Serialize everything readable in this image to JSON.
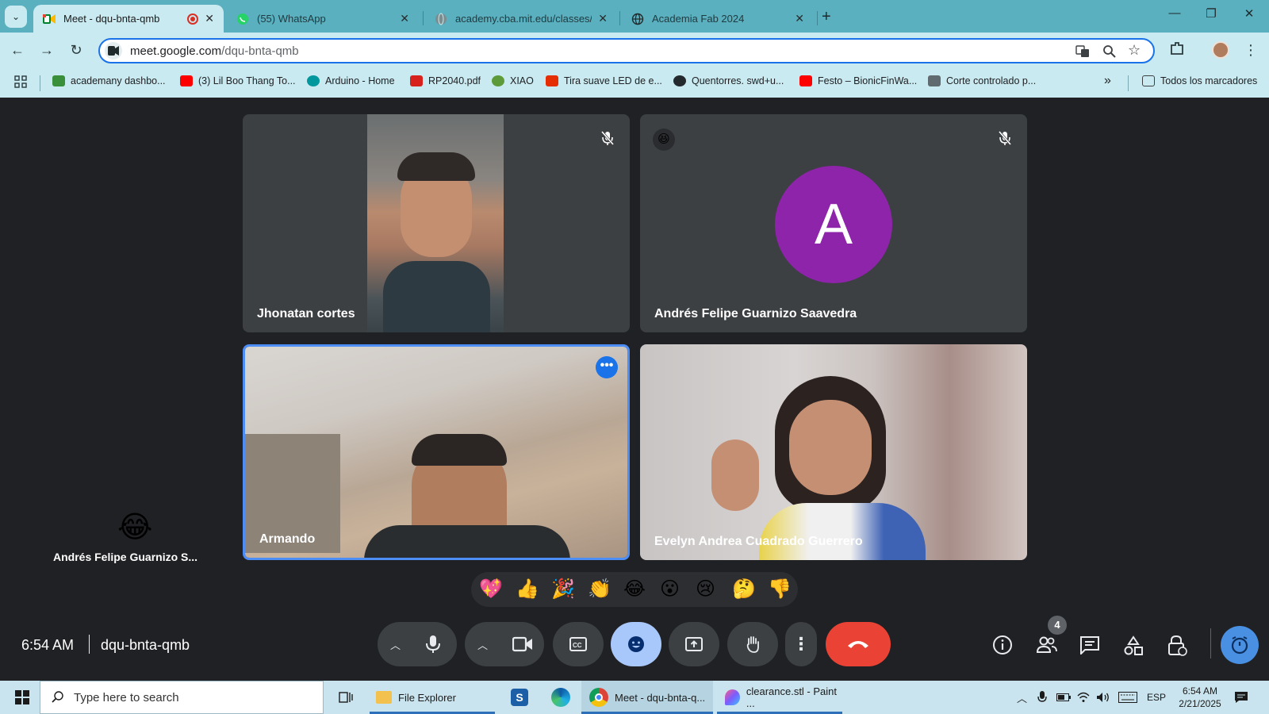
{
  "browser": {
    "tabs": [
      {
        "title": "Meet - dqu-bnta-qmb",
        "active": true
      },
      {
        "title": "(55) WhatsApp",
        "active": false
      },
      {
        "title": "academy.cba.mit.edu/classes/sc",
        "active": false
      },
      {
        "title": "Academia Fab 2024",
        "active": false
      }
    ],
    "url_domain": "meet.google.com",
    "url_path": "/dqu-bnta-qmb"
  },
  "bookmarks": [
    {
      "label": "academany dashbo..."
    },
    {
      "label": "(3) Lil Boo Thang To..."
    },
    {
      "label": "Arduino - Home"
    },
    {
      "label": "RP2040.pdf"
    },
    {
      "label": "XIAO"
    },
    {
      "label": "Tira suave LED de e..."
    },
    {
      "label": "Quentorres. swd+u..."
    },
    {
      "label": "Festo – BionicFinWa..."
    },
    {
      "label": "Corte controlado p..."
    }
  ],
  "bookmarks_all": "Todos los marcadores",
  "meet": {
    "participants": [
      {
        "name": "Jhonatan cortes",
        "muted": true
      },
      {
        "name": "Andrés Felipe Guarnizo Saavedra",
        "avatar_letter": "A",
        "avatar_color": "#8e24aa",
        "muted": true
      },
      {
        "name": "Armando",
        "speaking": true
      },
      {
        "name": "Evelyn Andrea Cuadrado Guerrero"
      }
    ],
    "side_reaction_name": "Andrés Felipe Guarnizo S...",
    "reaction_emojis": [
      "💖",
      "👍",
      "🎉",
      "👏",
      "😂",
      "😮",
      "😢",
      "🤔",
      "👎"
    ],
    "time": "6:54 AM",
    "meeting_code": "dqu-bnta-qmb",
    "people_count": "4",
    "end_call_color": "#ea4335",
    "reaction_active_color": "#a8c7fa"
  },
  "taskbar": {
    "search_placeholder": "Type here to search",
    "apps": [
      {
        "label": "File Explorer"
      },
      {
        "label": "Meet - dqu-bnta-q..."
      },
      {
        "label": "clearance.stl - Paint ..."
      }
    ],
    "lang": "ESP",
    "clock_time": "6:54 AM",
    "clock_date": "2/21/2025"
  }
}
